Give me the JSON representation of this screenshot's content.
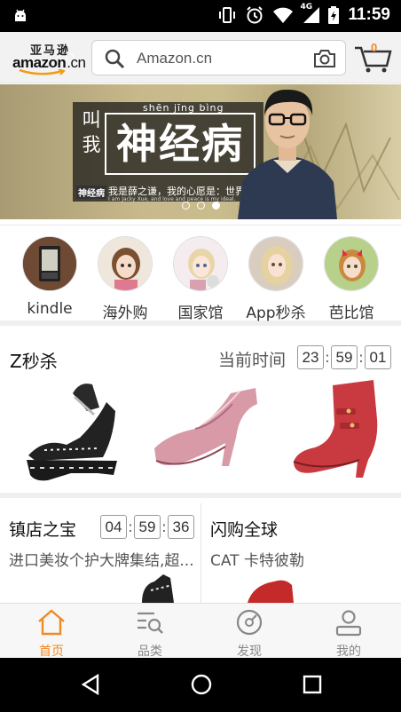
{
  "status_bar": {
    "time": "11:59",
    "network": "4G"
  },
  "header": {
    "logo_cn": "亚马逊",
    "logo_en": "amazon",
    "logo_suffix": ".cn",
    "search_placeholder": "Amazon.cn",
    "cart_count": "0"
  },
  "banner": {
    "side_text": "叫我",
    "pinyin": "shēn jīng bìng",
    "big_text": "神经病",
    "tag": "神经病",
    "subtitle": "我是薛之谦，我的心愿是：世界和平",
    "subtitle_en": "I am Jacky Xue, and love and peace is my ideal.",
    "dot_count": 3,
    "active_dot": 2
  },
  "categories": [
    {
      "label": "kindle",
      "icon": "kindle-icon"
    },
    {
      "label": "海外购",
      "icon": "doll-icon"
    },
    {
      "label": "国家馆",
      "icon": "doll-icon"
    },
    {
      "label": "App秒杀",
      "icon": "doll-icon"
    },
    {
      "label": "芭比馆",
      "icon": "doll-icon"
    }
  ],
  "flash_sale": {
    "title": "Z秒杀",
    "now_label": "当前时间",
    "timer": [
      "23",
      "59",
      "01"
    ],
    "items": [
      "black-platform-sandal",
      "pink-heel",
      "red-ankle-boot"
    ]
  },
  "cards": [
    {
      "title": "镇店之宝",
      "timer": [
        "04",
        "59",
        "36"
      ],
      "desc": "进口美妆个护大牌集结,超..."
    },
    {
      "title": "闪购全球",
      "desc": "CAT 卡特彼勒"
    }
  ],
  "tabs": [
    {
      "label": "首页",
      "icon": "home-icon",
      "active": true
    },
    {
      "label": "品类",
      "icon": "category-search-icon",
      "active": false
    },
    {
      "label": "发现",
      "icon": "compass-icon",
      "active": false
    },
    {
      "label": "我的",
      "icon": "user-icon",
      "active": false
    }
  ],
  "colors": {
    "accent": "#f08a24",
    "banner_bg": "#c7b98b",
    "shoe_red": "#c93a40",
    "shoe_pink": "#d99aa8"
  }
}
